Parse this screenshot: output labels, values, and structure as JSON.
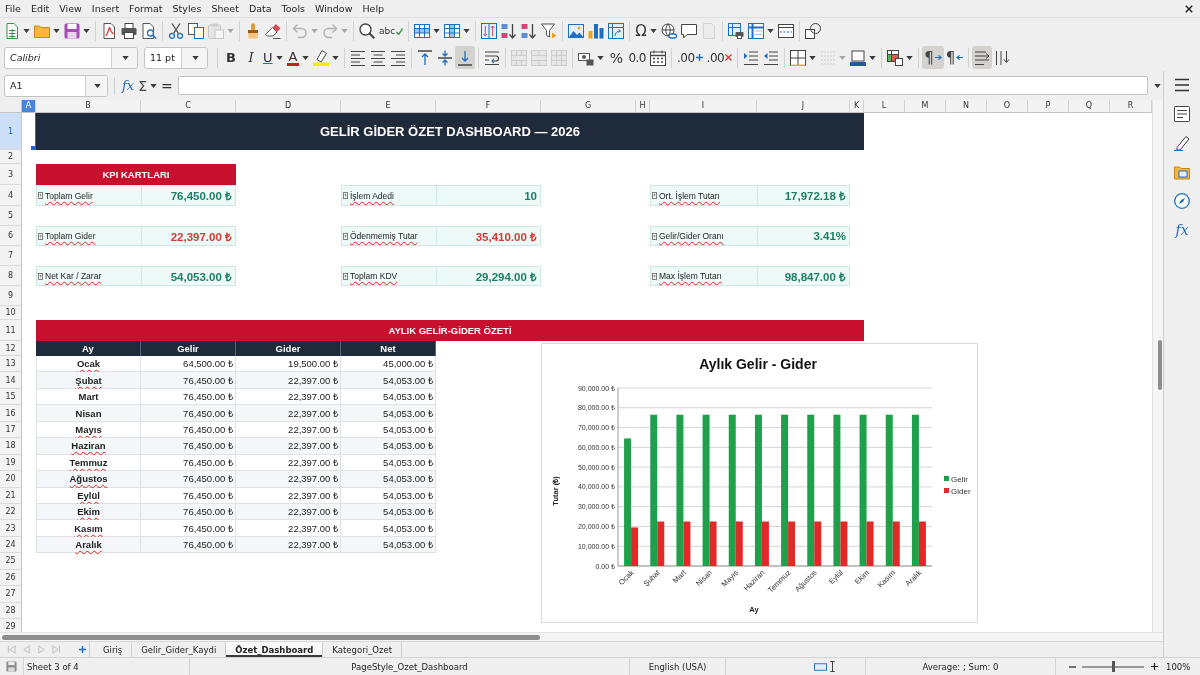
{
  "menu_bar": {
    "items": [
      "File",
      "Edit",
      "View",
      "Insert",
      "Format",
      "Styles",
      "Sheet",
      "Data",
      "Tools",
      "Window",
      "Help"
    ]
  },
  "toolbars": [
    {
      "groups": [
        [
          {
            "kind": "new",
            "dropdown": true,
            "disabled": false,
            "pressed": false
          },
          {
            "kind": "open",
            "dropdown": true,
            "disabled": false,
            "pressed": false
          },
          {
            "kind": "save",
            "dropdown": true,
            "disabled": false,
            "pressed": false
          }
        ],
        [
          {
            "kind": "pdf",
            "dropdown": false,
            "disabled": false,
            "pressed": false
          },
          {
            "kind": "print",
            "dropdown": false,
            "disabled": false,
            "pressed": false
          },
          {
            "kind": "preview",
            "dropdown": false,
            "disabled": false,
            "pressed": false
          }
        ],
        [
          {
            "kind": "cut",
            "dropdown": false,
            "disabled": false,
            "pressed": false
          },
          {
            "kind": "copy",
            "dropdown": false,
            "disabled": false,
            "pressed": false
          },
          {
            "kind": "paste",
            "dropdown": true,
            "disabled": true,
            "pressed": false
          }
        ],
        [
          {
            "kind": "clone",
            "dropdown": false,
            "disabled": false,
            "pressed": false
          },
          {
            "kind": "clear",
            "dropdown": false,
            "disabled": false,
            "pressed": false
          }
        ],
        [
          {
            "kind": "undo",
            "dropdown": true,
            "disabled": true,
            "pressed": false
          },
          {
            "kind": "redo",
            "dropdown": true,
            "disabled": true,
            "pressed": false
          }
        ],
        [
          {
            "kind": "find",
            "dropdown": false,
            "disabled": false,
            "pressed": false
          },
          {
            "kind": "spelling",
            "label": "abc",
            "dropdown": false,
            "disabled": false,
            "pressed": false
          }
        ],
        [
          {
            "kind": "rows",
            "dropdown": true,
            "disabled": false,
            "pressed": false
          },
          {
            "kind": "columns",
            "dropdown": true,
            "disabled": false,
            "pressed": false
          }
        ],
        [
          {
            "kind": "sort",
            "dropdown": false,
            "disabled": false,
            "pressed": false
          },
          {
            "kind": "ascending",
            "dropdown": false,
            "disabled": false,
            "pressed": false
          },
          {
            "kind": "descending",
            "dropdown": false,
            "disabled": false,
            "pressed": false
          },
          {
            "kind": "autofilter",
            "dropdown": false,
            "disabled": false,
            "pressed": false
          }
        ],
        [
          {
            "kind": "image",
            "dropdown": false,
            "disabled": false,
            "pressed": false
          },
          {
            "kind": "chart",
            "dropdown": false,
            "disabled": false,
            "pressed": false
          },
          {
            "kind": "pivot",
            "dropdown": false,
            "disabled": false,
            "pressed": false
          }
        ],
        [
          {
            "kind": "symbol",
            "label": "Ω",
            "dropdown": true,
            "disabled": false,
            "pressed": false
          },
          {
            "kind": "hyperlink",
            "dropdown": false,
            "disabled": false,
            "pressed": false
          },
          {
            "kind": "comment",
            "dropdown": false,
            "disabled": false,
            "pressed": false
          },
          {
            "kind": "headerfooter",
            "dropdown": false,
            "disabled": true,
            "pressed": false
          }
        ],
        [
          {
            "kind": "printarea",
            "dropdown": false,
            "disabled": false,
            "pressed": false
          },
          {
            "kind": "freeze",
            "dropdown": true,
            "disabled": false,
            "pressed": false
          },
          {
            "kind": "split",
            "dropdown": false,
            "disabled": false,
            "pressed": false
          }
        ],
        [
          {
            "kind": "draw",
            "dropdown": false,
            "disabled": false,
            "pressed": false
          }
        ]
      ]
    },
    {
      "groups": [
        [
          {
            "kind": "fontname",
            "value": "Calibri",
            "dropdown": true,
            "disabled": false,
            "pressed": false
          },
          {
            "kind": "fontsize",
            "value": "11 pt",
            "dropdown": true,
            "disabled": false,
            "pressed": false
          }
        ],
        [
          {
            "kind": "bold",
            "label": "B",
            "dropdown": false,
            "disabled": false,
            "pressed": false
          },
          {
            "kind": "italic",
            "label": "I",
            "dropdown": false,
            "disabled": false,
            "pressed": false
          },
          {
            "kind": "underline",
            "label": "U",
            "dropdown": true,
            "disabled": false,
            "pressed": false
          },
          {
            "kind": "fontcolor",
            "label": "A",
            "dropdown": true,
            "disabled": false,
            "pressed": false
          },
          {
            "kind": "highlight",
            "dropdown": true,
            "disabled": false,
            "pressed": false
          }
        ],
        [
          {
            "kind": "left",
            "dropdown": false,
            "disabled": false,
            "pressed": false
          },
          {
            "kind": "center",
            "dropdown": false,
            "disabled": false,
            "pressed": false
          },
          {
            "kind": "right",
            "dropdown": false,
            "disabled": false,
            "pressed": false
          }
        ],
        [
          {
            "kind": "top",
            "dropdown": false,
            "disabled": false,
            "pressed": false
          },
          {
            "kind": "middle",
            "dropdown": false,
            "disabled": false,
            "pressed": false
          },
          {
            "kind": "bottom",
            "dropdown": false,
            "disabled": false,
            "pressed": true
          }
        ],
        [
          {
            "kind": "wrap",
            "dropdown": false,
            "disabled": false,
            "pressed": false
          }
        ],
        [
          {
            "kind": "mergecenter",
            "dropdown": false,
            "disabled": true,
            "pressed": false
          },
          {
            "kind": "merge",
            "dropdown": false,
            "disabled": true,
            "pressed": false
          },
          {
            "kind": "unmerge",
            "dropdown": false,
            "disabled": true,
            "pressed": false
          }
        ],
        [
          {
            "kind": "currency",
            "dropdown": true,
            "disabled": false,
            "pressed": false
          },
          {
            "kind": "percent",
            "label": "%",
            "dropdown": false,
            "disabled": false,
            "pressed": false
          },
          {
            "kind": "number",
            "label": "0.0",
            "dropdown": false,
            "disabled": false,
            "pressed": false
          },
          {
            "kind": "date",
            "dropdown": false,
            "disabled": false,
            "pressed": false
          }
        ],
        [
          {
            "kind": "adddecimal",
            "label": ".00",
            "dropdown": false,
            "disabled": false,
            "pressed": false
          },
          {
            "kind": "deldecimal",
            "label": ".00",
            "dropdown": false,
            "disabled": false,
            "pressed": false
          }
        ],
        [
          {
            "kind": "indent",
            "dropdown": false,
            "disabled": false,
            "pressed": false
          },
          {
            "kind": "outdent",
            "dropdown": false,
            "disabled": false,
            "pressed": false
          }
        ],
        [
          {
            "kind": "borders",
            "dropdown": true,
            "disabled": false,
            "pressed": false
          },
          {
            "kind": "borderstyle",
            "dropdown": true,
            "disabled": true,
            "pressed": false
          },
          {
            "kind": "bordercolor",
            "dropdown": true,
            "disabled": false,
            "pressed": false
          }
        ],
        [
          {
            "kind": "conditional",
            "dropdown": true,
            "disabled": false,
            "pressed": false
          }
        ],
        [
          {
            "kind": "ltr",
            "label": "¶",
            "dropdown": false,
            "disabled": false,
            "pressed": true
          },
          {
            "kind": "rtl",
            "label": "¶",
            "dropdown": false,
            "disabled": false,
            "pressed": false
          }
        ],
        [
          {
            "kind": "horizontal",
            "dropdown": false,
            "disabled": false,
            "pressed": true
          },
          {
            "kind": "vertical",
            "dropdown": false,
            "disabled": false,
            "pressed": false
          }
        ]
      ]
    }
  ],
  "formula_bar": {
    "cell_ref": "A1",
    "tools": [
      {
        "kind": "wizard",
        "label": "fx",
        "dropdown": false
      },
      {
        "kind": "sum",
        "label": "Σ",
        "dropdown": true
      },
      {
        "kind": "formula",
        "label": "=",
        "dropdown": false
      }
    ]
  },
  "sidebar": {
    "items": [
      {
        "kind": "menu",
        "selected": false
      },
      {
        "kind": "properties",
        "selected": false
      },
      {
        "kind": "styles",
        "selected": false
      },
      {
        "kind": "gallery",
        "selected": false
      },
      {
        "kind": "navigator",
        "selected": false
      },
      {
        "kind": "functions",
        "label": "fx",
        "selected": false
      }
    ]
  },
  "sheet": {
    "column_headers": [
      {
        "label": "A",
        "selected": true
      },
      {
        "label": "B",
        "selected": false
      },
      {
        "label": "C",
        "selected": false
      },
      {
        "label": "D",
        "selected": false
      },
      {
        "label": "E",
        "selected": false
      },
      {
        "label": "F",
        "selected": false
      },
      {
        "label": "G",
        "selected": false
      },
      {
        "label": "H",
        "selected": false
      },
      {
        "label": "I",
        "selected": false
      },
      {
        "label": "J",
        "selected": false
      },
      {
        "label": "K",
        "selected": false
      },
      {
        "label": "L",
        "selected": false
      },
      {
        "label": "M",
        "selected": false
      },
      {
        "label": "N",
        "selected": false
      },
      {
        "label": "O",
        "selected": false
      },
      {
        "label": "P",
        "selected": false
      },
      {
        "label": "Q",
        "selected": false
      },
      {
        "label": "R",
        "selected": false
      }
    ],
    "row_headers": [
      {
        "label": "1",
        "selected": true
      },
      {
        "label": "2",
        "selected": false
      },
      {
        "label": "3",
        "selected": false
      },
      {
        "label": "4",
        "selected": false
      },
      {
        "label": "5",
        "selected": false
      },
      {
        "label": "6",
        "selected": false
      },
      {
        "label": "7",
        "selected": false
      },
      {
        "label": "8",
        "selected": false
      },
      {
        "label": "9",
        "selected": false
      },
      {
        "label": "10",
        "selected": false
      },
      {
        "label": "11",
        "selected": false
      },
      {
        "label": "12",
        "selected": false
      },
      {
        "label": "13",
        "selected": false
      },
      {
        "label": "14",
        "selected": false
      },
      {
        "label": "15",
        "selected": false
      },
      {
        "label": "16",
        "selected": false
      },
      {
        "label": "17",
        "selected": false
      },
      {
        "label": "18",
        "selected": false
      },
      {
        "label": "19",
        "selected": false
      },
      {
        "label": "20",
        "selected": false
      },
      {
        "label": "21",
        "selected": false
      },
      {
        "label": "22",
        "selected": false
      },
      {
        "label": "23",
        "selected": false
      },
      {
        "label": "24",
        "selected": false
      },
      {
        "label": "25",
        "selected": false
      },
      {
        "label": "26",
        "selected": false
      },
      {
        "label": "27",
        "selected": false
      },
      {
        "label": "28",
        "selected": false
      },
      {
        "label": "29",
        "selected": false
      }
    ],
    "title": "GELİR GİDER ÖZET DASHBOARD — 2026",
    "kpi_header": "KPI KARTLARI",
    "kpi_cards": [
      {
        "label": "Toplam Gelir",
        "value": "76,450.00 ₺",
        "color": "#1d7f68",
        "spell_error": true
      },
      {
        "label": "İşlem Adedi",
        "value": "10",
        "color": "#1d7f68",
        "spell_error": true
      },
      {
        "label": "Ort. İşlem Tutarı",
        "value": "17,972.18 ₺",
        "color": "#1d7f68",
        "spell_error": true
      },
      {
        "label": "Toplam Gider",
        "value": "22,397.00 ₺",
        "color": "#d23a32",
        "spell_error": true
      },
      {
        "label": "Ödenmemiş Tutar",
        "value": "35,410.00 ₺",
        "color": "#d23a32",
        "spell_error": true
      },
      {
        "label": "Gelir/Gider Oranı",
        "value": "3.41%",
        "color": "#1d7f68",
        "spell_error": true
      },
      {
        "label": "Net Kar / Zarar",
        "value": "54,053.00 ₺",
        "color": "#1d7f68",
        "spell_error": true
      },
      {
        "label": "Toplam KDV",
        "value": "29,294.00 ₺",
        "color": "#1d7f68",
        "spell_error": true
      },
      {
        "label": "Max İşlem Tutarı",
        "value": "98,847.00 ₺",
        "color": "#1d7f68",
        "spell_error": true
      }
    ],
    "summary_header": "AYLIK GELİR-GİDER ÖZETİ",
    "summary_table": {
      "columns": [
        "Ay",
        "Gelir",
        "Gider",
        "Net"
      ],
      "rows": [
        {
          "cells": [
            "Ocak",
            "64,500.00 ₺",
            "19,500.00 ₺",
            "45,000.00 ₺"
          ],
          "spell_error": true
        },
        {
          "cells": [
            "Şubat",
            "76,450.00 ₺",
            "22,397.00 ₺",
            "54,053.00 ₺"
          ],
          "spell_error": true
        },
        {
          "cells": [
            "Mart",
            "76,450.00 ₺",
            "22,397.00 ₺",
            "54,053.00 ₺"
          ],
          "spell_error": false
        },
        {
          "cells": [
            "Nisan",
            "76,450.00 ₺",
            "22,397.00 ₺",
            "54,053.00 ₺"
          ],
          "spell_error": false
        },
        {
          "cells": [
            "Mayıs",
            "76,450.00 ₺",
            "22,397.00 ₺",
            "54,053.00 ₺"
          ],
          "spell_error": true
        },
        {
          "cells": [
            "Haziran",
            "76,450.00 ₺",
            "22,397.00 ₺",
            "54,053.00 ₺"
          ],
          "spell_error": true
        },
        {
          "cells": [
            "Temmuz",
            "76,450.00 ₺",
            "22,397.00 ₺",
            "54,053.00 ₺"
          ],
          "spell_error": true
        },
        {
          "cells": [
            "Ağustos",
            "76,450.00 ₺",
            "22,397.00 ₺",
            "54,053.00 ₺"
          ],
          "spell_error": true
        },
        {
          "cells": [
            "Eylül",
            "76,450.00 ₺",
            "22,397.00 ₺",
            "54,053.00 ₺"
          ],
          "spell_error": true
        },
        {
          "cells": [
            "Ekim",
            "76,450.00 ₺",
            "22,397.00 ₺",
            "54,053.00 ₺"
          ],
          "spell_error": true
        },
        {
          "cells": [
            "Kasım",
            "76,450.00 ₺",
            "22,397.00 ₺",
            "54,053.00 ₺"
          ],
          "spell_error": true
        },
        {
          "cells": [
            "Aralık",
            "76,450.00 ₺",
            "22,397.00 ₺",
            "54,053.00 ₺"
          ],
          "spell_error": true
        }
      ]
    },
    "chart": {
      "chart_data": {
        "type": "bar",
        "title": "Aylık Gelir - Gider",
        "xlabel": "Ay",
        "ylabel": "Tutar (₺)",
        "categories": [
          "Ocak",
          "Şubat",
          "Mart",
          "Nisan",
          "Mayıs",
          "Haziran",
          "Temmuz",
          "Ağustos",
          "Eylül",
          "Ekim",
          "Kasım",
          "Aralık"
        ],
        "series": [
          {
            "name": "Gelir",
            "color": "#21a04b",
            "values": [
              64500,
              76500,
              76500,
              76500,
              76500,
              76500,
              76500,
              76500,
              76500,
              76500,
              76500,
              76500
            ]
          },
          {
            "name": "Gider",
            "color": "#e02a2a",
            "values": [
              19500,
              22500,
              22500,
              22500,
              22500,
              22500,
              22500,
              22500,
              22500,
              22500,
              22500,
              22500
            ]
          }
        ],
        "ylim": [
          0,
          90000
        ],
        "yticks": [
          {
            "value": 0,
            "label": "0.00 ₺"
          },
          {
            "value": 10000,
            "label": "10,000.00 ₺"
          },
          {
            "value": 20000,
            "label": "20,000.00 ₺"
          },
          {
            "value": 30000,
            "label": "30,000.00 ₺"
          },
          {
            "value": 40000,
            "label": "40,000.00 ₺"
          },
          {
            "value": 50000,
            "label": "50,000.00 ₺"
          },
          {
            "value": 60000,
            "label": "60,000.00 ₺"
          },
          {
            "value": 70000,
            "label": "70,000.00 ₺"
          },
          {
            "value": 80000,
            "label": "80,000.00 ₺"
          },
          {
            "value": 90000,
            "label": "90,000.00 ₺"
          }
        ],
        "grid": true,
        "legend": true
      }
    }
  },
  "sheet_tabs": {
    "navigation": [
      {
        "kind": "first",
        "disabled": true
      },
      {
        "kind": "previous",
        "disabled": true
      },
      {
        "kind": "next",
        "disabled": true
      },
      {
        "kind": "last",
        "disabled": true
      }
    ],
    "tabs": [
      {
        "label": "Giriş",
        "selected": false
      },
      {
        "label": "Gelir_Gider_Kaydi",
        "selected": false
      },
      {
        "label": "Özet_Dashboard",
        "selected": true
      },
      {
        "label": "Kategori_Ozet",
        "selected": false
      }
    ]
  },
  "status_bar": {
    "sheet_position": "Sheet 3 of 4",
    "page_style": "PageStyle_Ozet_Dashboard",
    "language": "English (USA)",
    "selection_summary": "Average: ; Sum: 0",
    "zoom": {
      "level": 0.5,
      "reading": "100%"
    }
  }
}
